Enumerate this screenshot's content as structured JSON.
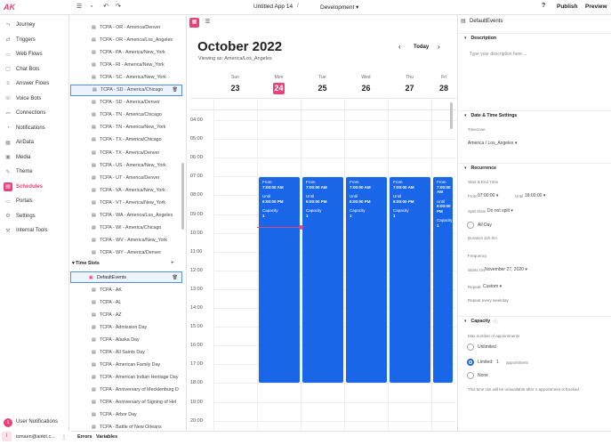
{
  "topbar": {
    "logo": "AK",
    "app_title": "Untitled App 14",
    "environment": "Development",
    "help": "?",
    "publish": "Publish",
    "preview": "Preview"
  },
  "nav": {
    "items": [
      {
        "label": "Journey",
        "icon": "journey-icon",
        "glyph": "⤳"
      },
      {
        "label": "Triggers",
        "icon": "triggers-icon",
        "glyph": "⇄"
      },
      {
        "label": "Web Flows",
        "icon": "web-flows-icon",
        "glyph": "▭"
      },
      {
        "label": "Chat Bots",
        "icon": "chat-bots-icon",
        "glyph": "▢"
      },
      {
        "label": "Answer Flows",
        "icon": "answer-flows-icon",
        "glyph": "≡"
      },
      {
        "label": "Voice Bots",
        "icon": "voice-bots-icon",
        "glyph": "☏"
      },
      {
        "label": "Connections",
        "icon": "connections-icon",
        "glyph": "⚯"
      },
      {
        "label": "Notifications",
        "icon": "notifications-icon",
        "glyph": "◔"
      },
      {
        "label": "AirData",
        "icon": "airdata-icon",
        "glyph": "▦"
      },
      {
        "label": "Media",
        "icon": "media-icon",
        "glyph": "▣"
      },
      {
        "label": "Theme",
        "icon": "theme-icon",
        "glyph": "✎"
      },
      {
        "label": "Schedules",
        "icon": "schedules-icon",
        "glyph": "▤"
      },
      {
        "label": "Portals",
        "icon": "portals-icon",
        "glyph": "▭"
      },
      {
        "label": "Settings",
        "icon": "settings-icon",
        "glyph": "⚙"
      },
      {
        "label": "Internal Tools",
        "icon": "internal-tools-icon",
        "glyph": "⚒"
      }
    ],
    "active": "Schedules",
    "user_notifications": "User Notifications",
    "notif_count": "1",
    "user_email": "ismaen@airkit.c...",
    "avatar": "I"
  },
  "tree": {
    "items": [
      "TCPA - OR - America/Denver",
      "TCPA - OR - America/Los_Angeles",
      "TCPA - PA - America/New_York",
      "TCPA - RI - America/New_York",
      "TCPA - SC - America/New_York",
      "TCPA - SD - America/Chicago",
      "TCPA - SD - America/Denver",
      "TCPA - TN - America/Chicago",
      "TCPA - TN - America/New_York",
      "TCPA - TX - America/Chicago",
      "TCPA - TX - America/Denver",
      "TCPA - US - America/New_York",
      "TCPA - UT - America/Denver",
      "TCPA - VA - America/New_York",
      "TCPA - VT - America/New_York",
      "TCPA - WA - America/Los_Angeles",
      "TCPA - WI - America/Chicago",
      "TCPA - WV - America/New_York",
      "TCPA - WY - America/Denver"
    ],
    "selected_index": 5,
    "timeslots_header": "Time Slots",
    "add": "+",
    "selected_event": "DefaultEvents",
    "timeslots": [
      "TCPA - AK",
      "TCPA - AL",
      "TCPA - AZ",
      "TCPA - Admission Day",
      "TCPA - Alaska Day",
      "TCPA - All Saints Day",
      "TCPA - American Family Day",
      "TCPA - American Indian Heritage Day",
      "TCPA - Anniversary of Mecklenburg D",
      "TCPA - Anniversary of Signing of Hel",
      "TCPA - Arbor Day",
      "TCPA - Battle of New Orleans"
    ]
  },
  "calendar": {
    "month": "October 2022",
    "viewing_as": "Viewing as: America/Los_Angeles",
    "today": "Today",
    "days": [
      {
        "name": "Sun",
        "date": "23"
      },
      {
        "name": "Mon",
        "date": "24"
      },
      {
        "name": "Tue",
        "date": "25"
      },
      {
        "name": "Wed",
        "date": "26"
      },
      {
        "name": "Thu",
        "date": "27"
      },
      {
        "name": "Fri",
        "date": "28"
      }
    ],
    "today_date": "24",
    "hours": [
      "04:00",
      "05:00",
      "06:00",
      "07:00",
      "08:00",
      "09:00",
      "10:00",
      "11:00",
      "12:00",
      "13:00",
      "14:00",
      "15:00",
      "16:00",
      "17:00",
      "18:00",
      "19:00",
      "20:00"
    ],
    "event": {
      "from_label": "From",
      "from": "7:00:00 AM",
      "until_label": "Until",
      "until": "6:00:00 PM",
      "capacity_label": "Capacity",
      "capacity": "1"
    }
  },
  "panel": {
    "title": "DefaultEvents",
    "description_hdr": "Description",
    "description_placeholder": "Type your description here ...",
    "dt_hdr": "Date & Time Settings",
    "timezone_label": "Timezone",
    "timezone": "America / Los_Angeles",
    "recurrence_hdr": "Recurrence",
    "start_end_label": "Start & End Time",
    "from_label": "From",
    "from": "07:00:00",
    "until_label": "Until",
    "until": "18:00:00",
    "split_label": "Split Slots",
    "split": "Do not split",
    "allday": "All Day",
    "duration": "Duration 11h 0m",
    "frequency_label": "Frequency",
    "starts_on_label": "Starts On",
    "starts_on": "November 27, 2020",
    "repeat_label": "Repeat",
    "repeat": "Custom",
    "repeat_note": "Repeat every weekday",
    "capacity_hdr": "Capacity",
    "max_label": "Max number of appointments",
    "opt_unlimited": "Unlimited",
    "opt_limited": "Limited:",
    "limited_value": "1",
    "limited_unit": "appointment",
    "opt_none": "None",
    "capacity_note": "This time slot will be unavailable after 1 appointment is booked."
  },
  "bottom": {
    "errors": "Errors",
    "variables": "Variables"
  },
  "colors": {
    "accent": "#e8427c",
    "event": "#1a66e8"
  }
}
